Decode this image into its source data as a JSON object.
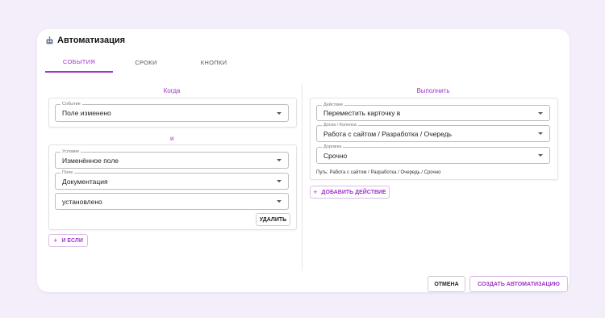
{
  "dialog": {
    "title": "Автоматизация",
    "title_icon": "robot-icon"
  },
  "tabs": [
    {
      "label": "СОБЫТИЯ",
      "active": true
    },
    {
      "label": "СРОКИ",
      "active": false
    },
    {
      "label": "КНОПКИ",
      "active": false
    }
  ],
  "left": {
    "heading": "Когда",
    "event": {
      "label": "Событие",
      "value": "Поле изменено"
    },
    "and_label": "и",
    "condition": {
      "label": "Условие",
      "value": "Изменённое поле"
    },
    "field": {
      "label": "Поле",
      "value": "Документация"
    },
    "state": {
      "value": "установлено"
    },
    "delete_label": "УДАЛИТЬ",
    "add_if_label": "И ЕСЛИ"
  },
  "right": {
    "heading": "Выполнить",
    "action": {
      "label": "Действие",
      "value": "Переместить карточку в"
    },
    "board": {
      "label": "Доска / Колонка",
      "value": "Работа с сайтом / Разработка / Очередь"
    },
    "lane": {
      "label": "Дорожка",
      "value": "Срочно"
    },
    "path": "Путь: Работа с сайтом / Разработка / Очередь / Срочно",
    "add_action_label": "ДОБАВИТЬ ДЕЙСТВИЕ"
  },
  "footer": {
    "cancel_label": "ОТМЕНА",
    "create_label": "СОЗДАТЬ АВТОМАТИЗАЦИЮ"
  },
  "colors": {
    "accent": "#a035c8",
    "background": "#f3eefa"
  }
}
